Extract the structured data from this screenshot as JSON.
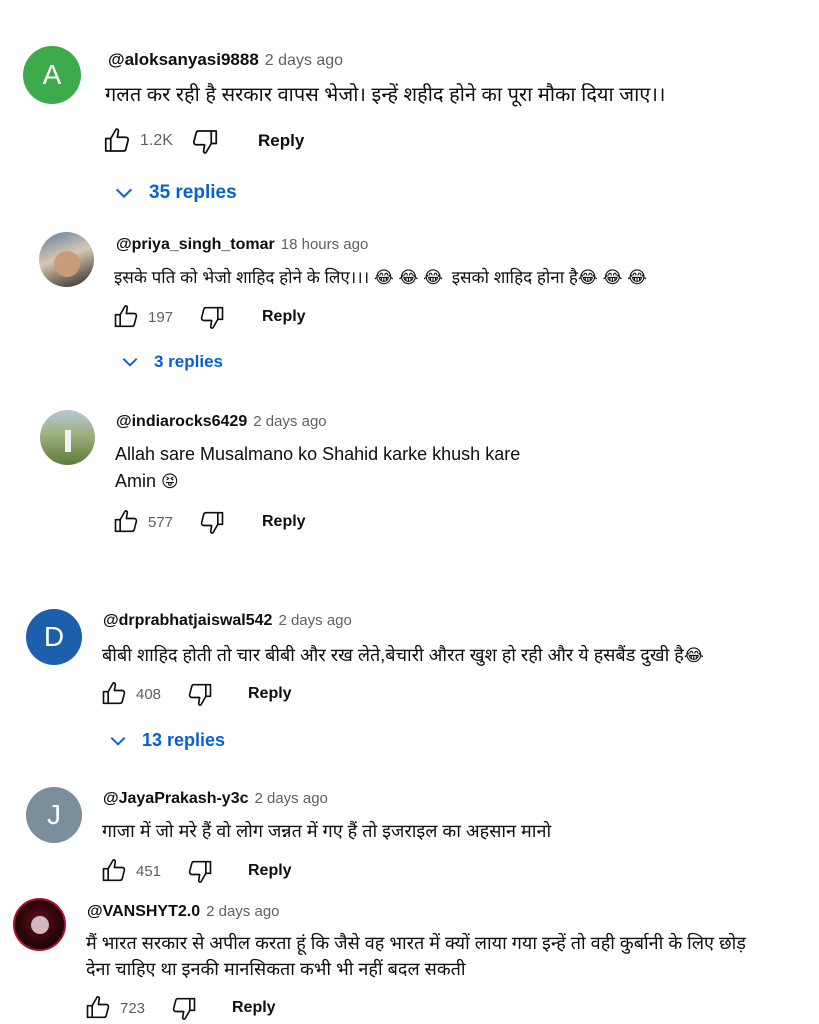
{
  "comments": [
    {
      "author": "@aloksanyasi9888",
      "time": "2 days ago",
      "avatar_letter": "A",
      "avatar_color": "#3dab4b",
      "text": "गलत कर रही है सरकार वापस भेजो। इन्हें शहीद होने का पूरा मौका दिया जाए।।",
      "likes": "1.2K",
      "reply_label": "Reply",
      "replies_label": "35 replies"
    },
    {
      "author": "@priya_singh_tomar",
      "time": "18 hours ago",
      "text_a": "इसके पति को भेजो शाहिद होने के लिए।।।",
      "text_b": "इसको शाहिद होना है",
      "emoji": "😂",
      "likes": "197",
      "reply_label": "Reply",
      "replies_label": "3 replies"
    },
    {
      "author": "@indiarocks6429",
      "time": "2 days ago",
      "line1": "Allah sare Musalmano ko Shahid karke khush kare",
      "line2": "Amin",
      "emoji": "😝",
      "likes": "577",
      "reply_label": "Reply"
    },
    {
      "author": "@drprabhatjaiswal542",
      "time": "2 days ago",
      "avatar_letter": "D",
      "avatar_color": "#1b5fad",
      "text": "बीबी शाहिद होती तो चार बीबी और रख लेते,बेचारी औरत खुश हो रही और ये हसबैंड दुखी है",
      "emoji": "😂",
      "likes": "408",
      "reply_label": "Reply",
      "replies_label": "13 replies"
    },
    {
      "author": "@JayaPrakash-y3c",
      "time": "2 days ago",
      "avatar_letter": "J",
      "avatar_color": "#7b8e9c",
      "text": "गाजा में जो मरे हैं वो लोग जन्नत में गए हैं तो इजराइल का अहसान मानो",
      "likes": "451",
      "reply_label": "Reply"
    },
    {
      "author": "@VANSHYT2.0",
      "time": "2 days ago",
      "line1": "मैं भारत सरकार से अपील करता हूं कि जैसे वह भारत में क्यों लाया गया इन्हें तो वही कुर्बानी के लिए छोड़",
      "line2": "देना चाहिए था इनकी मानसिकता कभी भी नहीं बदल सकती",
      "likes": "723",
      "reply_label": "Reply"
    }
  ]
}
